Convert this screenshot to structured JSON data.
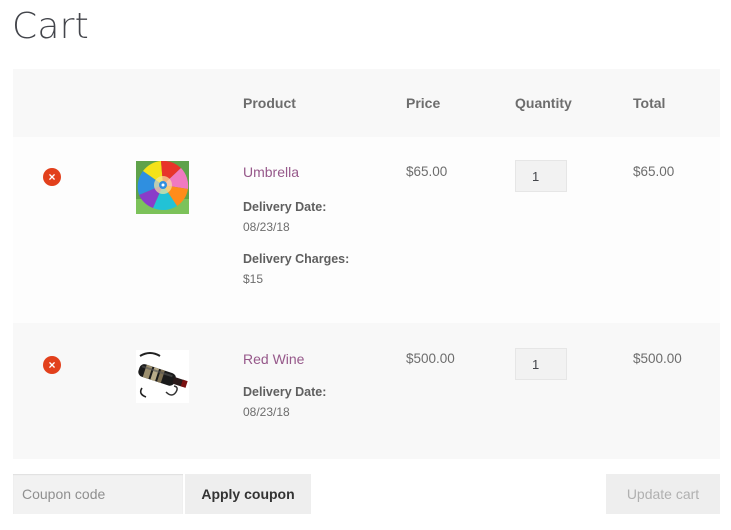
{
  "page": {
    "title": "Cart"
  },
  "table": {
    "headers": {
      "remove": "",
      "thumbnail": "",
      "product": "Product",
      "price": "Price",
      "quantity": "Quantity",
      "total": "Total"
    }
  },
  "items": [
    {
      "name": "Umbrella",
      "remove_symbol": "×",
      "meta": [
        {
          "label": "Delivery Date:",
          "value": "08/23/18"
        },
        {
          "label": "Delivery Charges:",
          "value": "$15"
        }
      ],
      "price": "$65.00",
      "quantity": "1",
      "total": "$65.00"
    },
    {
      "name": "Red Wine",
      "remove_symbol": "×",
      "meta": [
        {
          "label": "Delivery Date:",
          "value": "08/23/18"
        }
      ],
      "price": "$500.00",
      "quantity": "1",
      "total": "$500.00"
    }
  ],
  "actions": {
    "coupon_placeholder": "Coupon code",
    "apply_coupon": "Apply coupon",
    "update_cart": "Update cart"
  },
  "colors": {
    "accent": "#96588a",
    "remove": "#e2401c",
    "header_bg": "#f8f8f8"
  },
  "icons": {
    "remove": "remove-icon",
    "umbrella_thumb": "umbrella-image",
    "wine_thumb": "wine-bottle-image"
  }
}
